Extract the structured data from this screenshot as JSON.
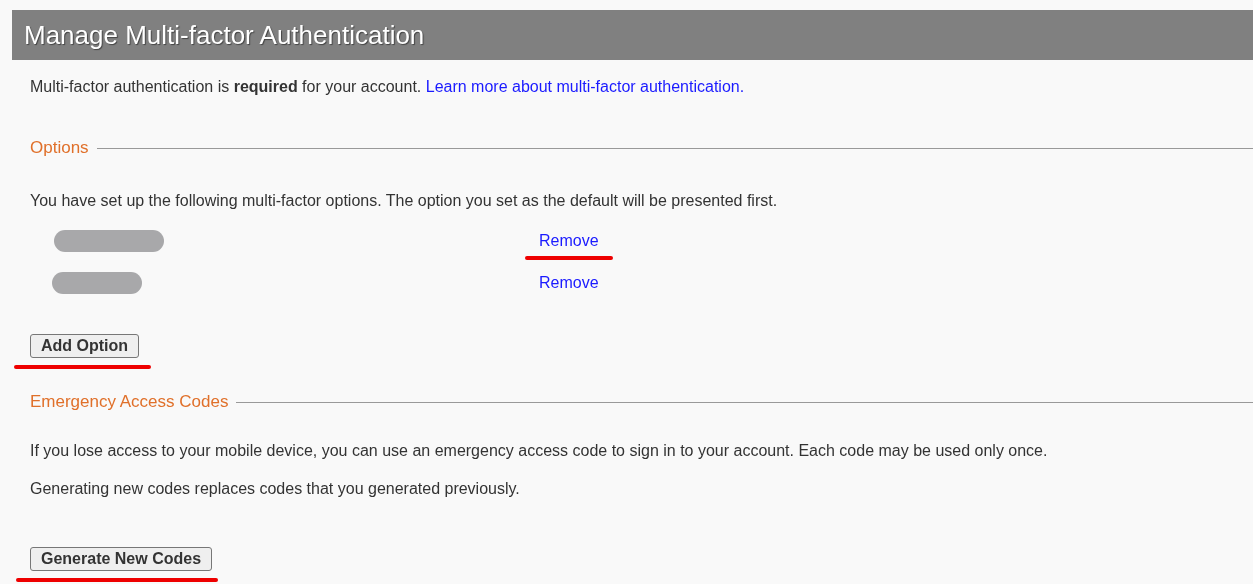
{
  "header": {
    "title": "Manage Multi-factor Authentication"
  },
  "intro": {
    "text": "Multi-factor authentication is **required** for your account.",
    "link": "Learn more about multi-factor authentication."
  },
  "options": {
    "heading": "Options",
    "description": "You have set up the following multi-factor options. The option you set as the default will be presented first.",
    "items": [
      {
        "kind": "redacted",
        "action": "Remove",
        "underlined": true
      },
      {
        "kind": "redacted",
        "action": "Remove",
        "underlined": false
      }
    ],
    "add_button": {
      "label": "Add Option",
      "underlined": true
    }
  },
  "emergency": {
    "heading": "Emergency Access Codes",
    "paragraphs": [
      "If you lose access to your mobile device, you can use an emergency access code to sign in to your account. Each code may be used only once.",
      "Generating new codes replaces codes that you generated previously."
    ],
    "button": {
      "label": "Generate New Codes",
      "underlined": true
    }
  }
}
